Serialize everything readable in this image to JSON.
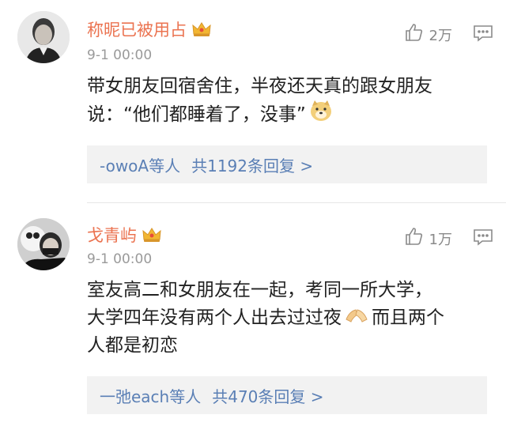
{
  "comments": [
    {
      "username": "称昵已被用占",
      "time": "9-1 00:00",
      "likes": "2万",
      "text_line1": "带女朋友回宿舍住，半夜还天真的跟女朋友",
      "text_line2": "说：“他们都睡着了，没事”",
      "reply_who": "-owoA等人",
      "reply_count": "共1192条回复 >",
      "emoji": "doge-face-icon"
    },
    {
      "username": "戈青屿",
      "time": "9-1 00:00",
      "likes": "1万",
      "text_line1": "室友高二和女朋友在一起，考同一所大学，",
      "text_line2": "大学四年没有两个人出去过过夜",
      "text_line2b": "而且两个",
      "text_line3": "人都是初恋",
      "reply_who": "一弛each等人",
      "reply_count": "共470条回复 >",
      "emoji": "folded-hands-icon"
    }
  ],
  "colors": {
    "username": "#eb7350",
    "link": "#5a7fb5",
    "meta": "#9a9a9a"
  }
}
